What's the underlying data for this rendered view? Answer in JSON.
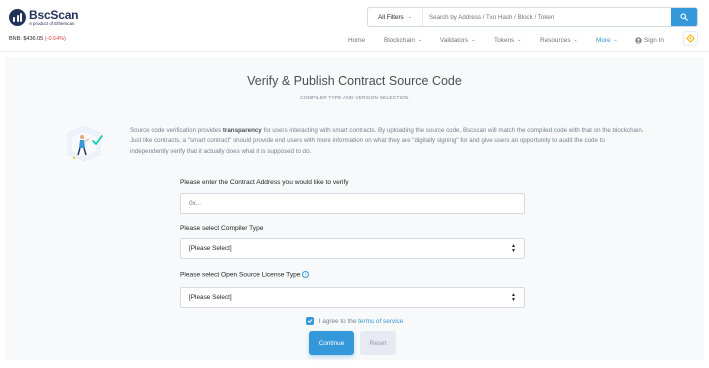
{
  "header": {
    "logo_name": "BscScan",
    "logo_sub": "A product of Etherscan",
    "price_label": "BNB: $436.05",
    "price_change": "(-0.64%)",
    "filter_label": "All Filters",
    "search_placeholder": "Search by Address / Txn Hash / Block / Token",
    "nav": {
      "home": "Home",
      "blockchain": "Blockchain",
      "validators": "Validators",
      "tokens": "Tokens",
      "resources": "Resources",
      "more": "More",
      "signin": "Sign In"
    }
  },
  "page": {
    "title": "Verify & Publish Contract Source Code",
    "subtitle": "COMPILER TYPE AND VERSION SELECTION",
    "info_pre": "Source code verification provides ",
    "info_bold": "transparency",
    "info_post": " for users interacting with smart contracts. By uploading the source code, Bscscan will match the compiled code with that on the blockchain. Just like contracts, a \"smart contract\" should provide end users with more information on what they are \"digitally signing\" for and give users an opportunity to audit the code to independently verify that it actually does what it is supposed to do."
  },
  "form": {
    "address_label": "Please enter the Contract Address you would like to verify",
    "address_placeholder": "0x...",
    "compiler_label": "Please select Compiler Type",
    "compiler_value": "[Please Select]",
    "license_label": "Please select Open Source License Type",
    "license_value": "[Please Select]",
    "agree_text": "I agree to the ",
    "agree_link": "terms of service",
    "continue_label": "Continue",
    "reset_label": "Reset"
  },
  "colors": {
    "accent": "#3498db",
    "brand": "#21325b",
    "negative": "#de4437",
    "bnb": "#f0b90b"
  }
}
